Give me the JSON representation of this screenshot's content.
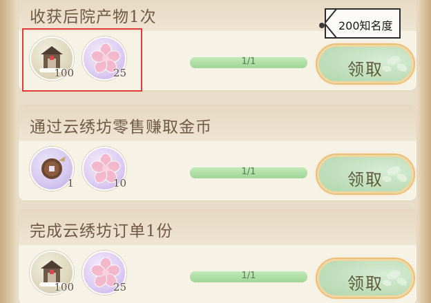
{
  "tasks": [
    {
      "title": "收获后院产物1次",
      "rewards": [
        {
          "icon": "building-icon",
          "count": "100"
        },
        {
          "icon": "pink-petal-icon",
          "count": "25"
        }
      ],
      "progress": {
        "text": "1/1",
        "fraction": 1.0
      },
      "claim_label": "领取"
    },
    {
      "title": "通过云绣坊零售赚取金币",
      "rewards": [
        {
          "icon": "coin-icon",
          "count": "1"
        },
        {
          "icon": "pink-petal-icon",
          "count": "10"
        }
      ],
      "progress": {
        "text": "1/1",
        "fraction": 1.0
      },
      "claim_label": "领取"
    },
    {
      "title": "完成云绣坊订单1份",
      "rewards": [
        {
          "icon": "building-icon",
          "count": "100"
        },
        {
          "icon": "pink-petal-icon",
          "count": "25"
        }
      ],
      "progress": {
        "text": "1/1",
        "fraction": 1.0
      },
      "claim_label": "领取"
    }
  ],
  "annotation": {
    "tag_text": "200知名度",
    "highlight_color": "#e03a3a"
  },
  "colors": {
    "title_text": "#6e5a44",
    "progress_fill": "#a9d9a2",
    "button_fill": "#c4e1c0",
    "button_border": "#e9be78"
  }
}
